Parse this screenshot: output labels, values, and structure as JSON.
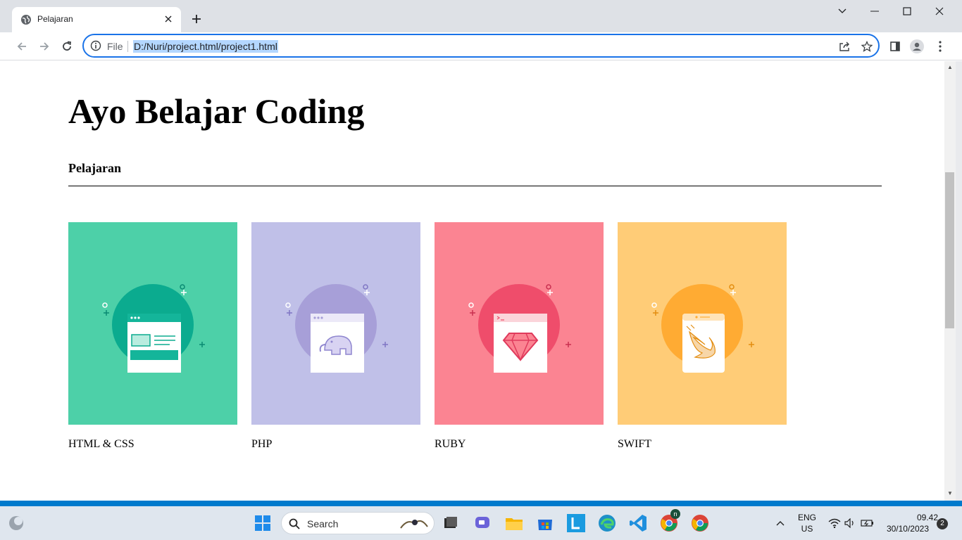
{
  "browser": {
    "tab_title": "Pelajaran",
    "file_label": "File",
    "url": "D:/Nuri/project.html/project1.html"
  },
  "page": {
    "title": "Ayo Belajar Coding",
    "section_title": "Pelajaran",
    "courses": [
      {
        "label": "HTML & CSS",
        "color": "#4dd0a8",
        "icon": "web-page-icon"
      },
      {
        "label": "PHP",
        "color": "#c0c0e8",
        "icon": "elephant-icon"
      },
      {
        "label": "RUBY",
        "color": "#fb8492",
        "icon": "ruby-gem-icon"
      },
      {
        "label": "SWIFT",
        "color": "#ffcc77",
        "icon": "swift-bird-icon"
      }
    ]
  },
  "taskbar": {
    "search_label": "Search",
    "lang_top": "ENG",
    "lang_bottom": "US",
    "time": "09.42",
    "date": "30/10/2023",
    "notification_count": "2",
    "chrome_badge": "n"
  }
}
